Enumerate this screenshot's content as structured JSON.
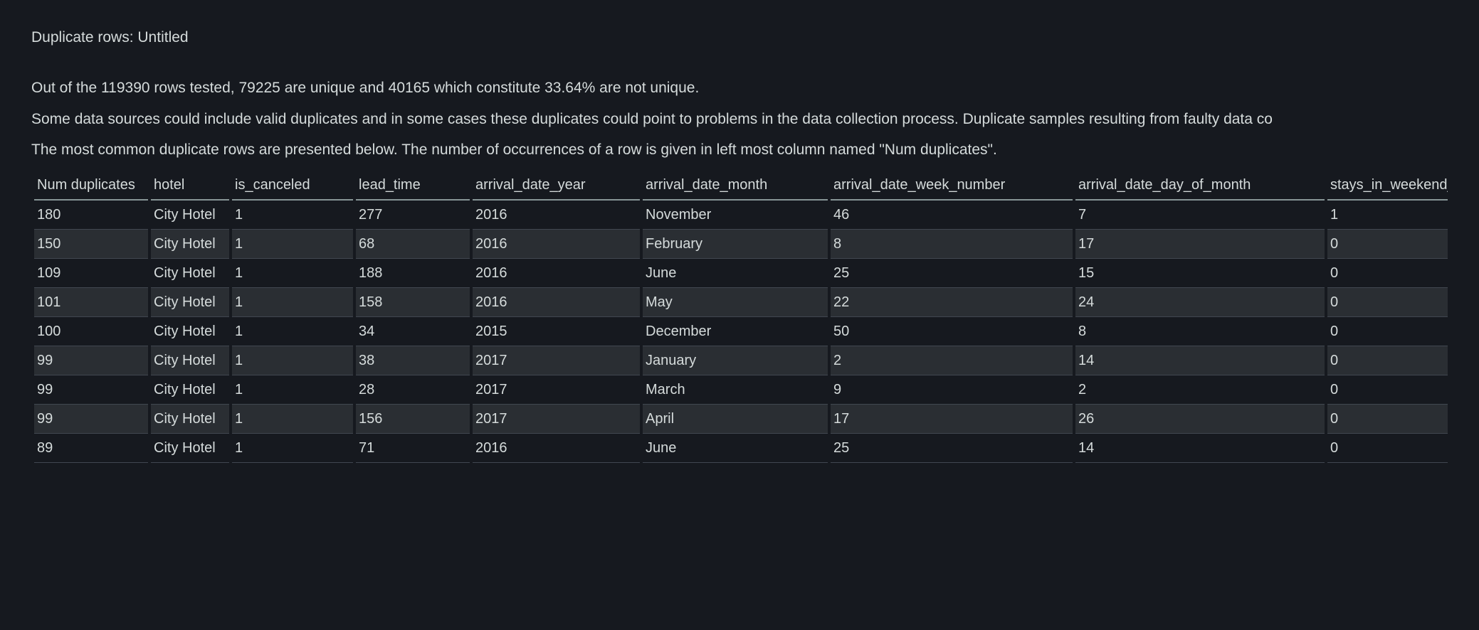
{
  "title": "Duplicate rows: Untitled",
  "summary": {
    "line1": "Out of the 119390 rows tested, 79225 are unique and 40165 which constitute 33.64% are not unique.",
    "line2": "Some data sources could include valid duplicates and in some cases these duplicates could point to problems in the data collection process. Duplicate samples resulting from faulty data co",
    "line3": "The most common duplicate rows are presented below. The number of occurrences of a row is given in left most column named \"Num duplicates\"."
  },
  "table": {
    "headers": {
      "num_duplicates": "Num duplicates",
      "hotel": "hotel",
      "is_canceled": "is_canceled",
      "lead_time": "lead_time",
      "arrival_date_year": "arrival_date_year",
      "arrival_date_month": "arrival_date_month",
      "arrival_date_week_number": "arrival_date_week_number",
      "arrival_date_day_of_month": "arrival_date_day_of_month",
      "stays_in_weekend_nights": "stays_in_weekend_nights"
    },
    "rows": [
      {
        "num_duplicates": "180",
        "hotel": "City Hotel",
        "is_canceled": "1",
        "lead_time": "277",
        "arrival_date_year": "2016",
        "arrival_date_month": "November",
        "arrival_date_week_number": "46",
        "arrival_date_day_of_month": "7",
        "stays_in_weekend_nights": "1"
      },
      {
        "num_duplicates": "150",
        "hotel": "City Hotel",
        "is_canceled": "1",
        "lead_time": "68",
        "arrival_date_year": "2016",
        "arrival_date_month": "February",
        "arrival_date_week_number": "8",
        "arrival_date_day_of_month": "17",
        "stays_in_weekend_nights": "0"
      },
      {
        "num_duplicates": "109",
        "hotel": "City Hotel",
        "is_canceled": "1",
        "lead_time": "188",
        "arrival_date_year": "2016",
        "arrival_date_month": "June",
        "arrival_date_week_number": "25",
        "arrival_date_day_of_month": "15",
        "stays_in_weekend_nights": "0"
      },
      {
        "num_duplicates": "101",
        "hotel": "City Hotel",
        "is_canceled": "1",
        "lead_time": "158",
        "arrival_date_year": "2016",
        "arrival_date_month": "May",
        "arrival_date_week_number": "22",
        "arrival_date_day_of_month": "24",
        "stays_in_weekend_nights": "0"
      },
      {
        "num_duplicates": "100",
        "hotel": "City Hotel",
        "is_canceled": "1",
        "lead_time": "34",
        "arrival_date_year": "2015",
        "arrival_date_month": "December",
        "arrival_date_week_number": "50",
        "arrival_date_day_of_month": "8",
        "stays_in_weekend_nights": "0"
      },
      {
        "num_duplicates": "99",
        "hotel": "City Hotel",
        "is_canceled": "1",
        "lead_time": "38",
        "arrival_date_year": "2017",
        "arrival_date_month": "January",
        "arrival_date_week_number": "2",
        "arrival_date_day_of_month": "14",
        "stays_in_weekend_nights": "0"
      },
      {
        "num_duplicates": "99",
        "hotel": "City Hotel",
        "is_canceled": "1",
        "lead_time": "28",
        "arrival_date_year": "2017",
        "arrival_date_month": "March",
        "arrival_date_week_number": "9",
        "arrival_date_day_of_month": "2",
        "stays_in_weekend_nights": "0"
      },
      {
        "num_duplicates": "99",
        "hotel": "City Hotel",
        "is_canceled": "1",
        "lead_time": "156",
        "arrival_date_year": "2017",
        "arrival_date_month": "April",
        "arrival_date_week_number": "17",
        "arrival_date_day_of_month": "26",
        "stays_in_weekend_nights": "0"
      },
      {
        "num_duplicates": "89",
        "hotel": "City Hotel",
        "is_canceled": "1",
        "lead_time": "71",
        "arrival_date_year": "2016",
        "arrival_date_month": "June",
        "arrival_date_week_number": "25",
        "arrival_date_day_of_month": "14",
        "stays_in_weekend_nights": "0"
      }
    ]
  }
}
